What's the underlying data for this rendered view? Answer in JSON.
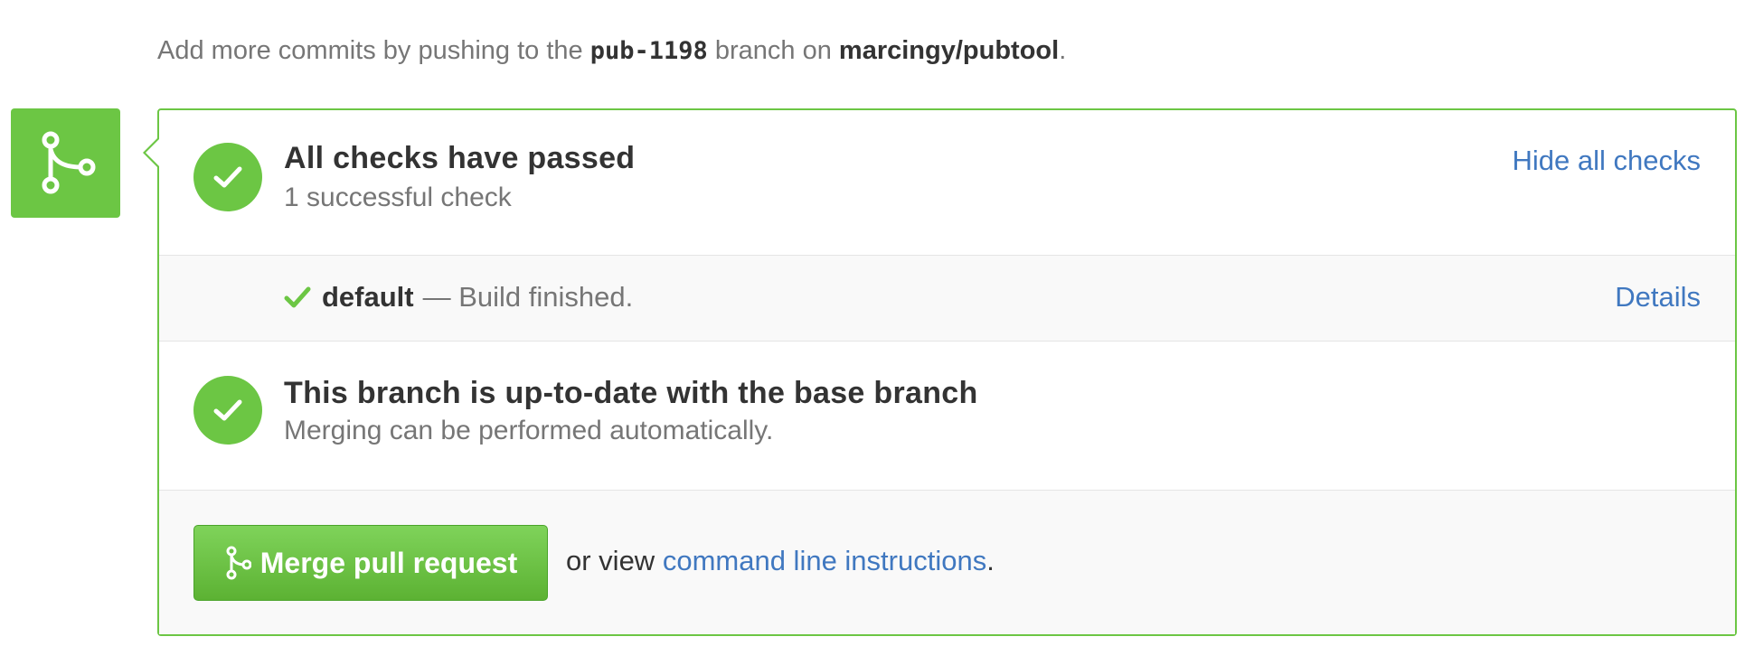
{
  "note": {
    "prefix": "Add more commits by pushing to the",
    "branch": "pub-1198",
    "middle": "branch on",
    "repo": "marcingy/pubtool",
    "suffix": "."
  },
  "checks": {
    "title": "All checks have passed",
    "subtitle": "1 successful check",
    "toggle_label": "Hide all checks"
  },
  "status": {
    "context": "default",
    "description": "— Build finished.",
    "details_label": "Details"
  },
  "branch_state": {
    "title": "This branch is up-to-date with the base branch",
    "subtitle": "Merging can be performed automatically."
  },
  "merge": {
    "button_label": "Merge pull request",
    "alt_prefix": "or view",
    "alt_link": "command line instructions",
    "alt_suffix": "."
  },
  "icons": {
    "badge": "git-merge-icon",
    "check": "check-icon",
    "button": "git-merge-icon"
  },
  "colors": {
    "success": "#6cc644",
    "link": "#4078c0",
    "muted": "#767676"
  }
}
